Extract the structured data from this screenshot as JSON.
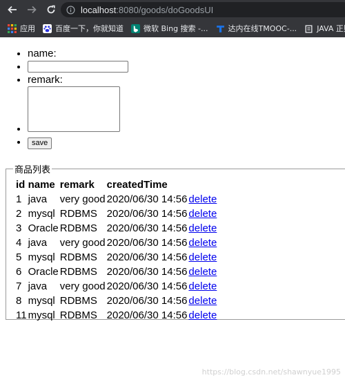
{
  "browser": {
    "url_host": "localhost",
    "url_rest": ":8080/goods/doGoodsUI",
    "bookmarks": [
      {
        "label": "应用",
        "icon": "apps-grid-icon"
      },
      {
        "label": "百度一下，你就知道",
        "icon": "baidu-paw-icon"
      },
      {
        "label": "微软 Bing 搜索 -...",
        "icon": "bing-icon"
      },
      {
        "label": "达内在线TMOOC-...",
        "icon": "tmooc-icon"
      },
      {
        "label": "JAVA 正则",
        "icon": "java-icon"
      }
    ]
  },
  "form": {
    "name_label": "name:",
    "name_value": "",
    "remark_label": "remark:",
    "remark_value": "",
    "save_label": "save"
  },
  "goods": {
    "legend": "商品列表",
    "headers": [
      "id",
      "name",
      "remark",
      "createdTime"
    ],
    "delete_label": "delete",
    "rows": [
      {
        "id": "1",
        "name": "java",
        "remark": "very good",
        "createdTime": "2020/06/30 14:56"
      },
      {
        "id": "2",
        "name": "mysql",
        "remark": "RDBMS",
        "createdTime": "2020/06/30 14:56"
      },
      {
        "id": "3",
        "name": "Oracle",
        "remark": "RDBMS",
        "createdTime": "2020/06/30 14:56"
      },
      {
        "id": "4",
        "name": "java",
        "remark": "very good",
        "createdTime": "2020/06/30 14:56"
      },
      {
        "id": "5",
        "name": "mysql",
        "remark": "RDBMS",
        "createdTime": "2020/06/30 14:56"
      },
      {
        "id": "6",
        "name": "Oracle",
        "remark": "RDBMS",
        "createdTime": "2020/06/30 14:56"
      },
      {
        "id": "7",
        "name": "java",
        "remark": "very good",
        "createdTime": "2020/06/30 14:56"
      },
      {
        "id": "8",
        "name": "mysql",
        "remark": "RDBMS",
        "createdTime": "2020/06/30 14:56"
      },
      {
        "id": "11",
        "name": "mysql",
        "remark": "RDBMS",
        "createdTime": "2020/06/30 14:56"
      }
    ]
  },
  "watermark": "https://blog.csdn.net/shawnyue1995"
}
